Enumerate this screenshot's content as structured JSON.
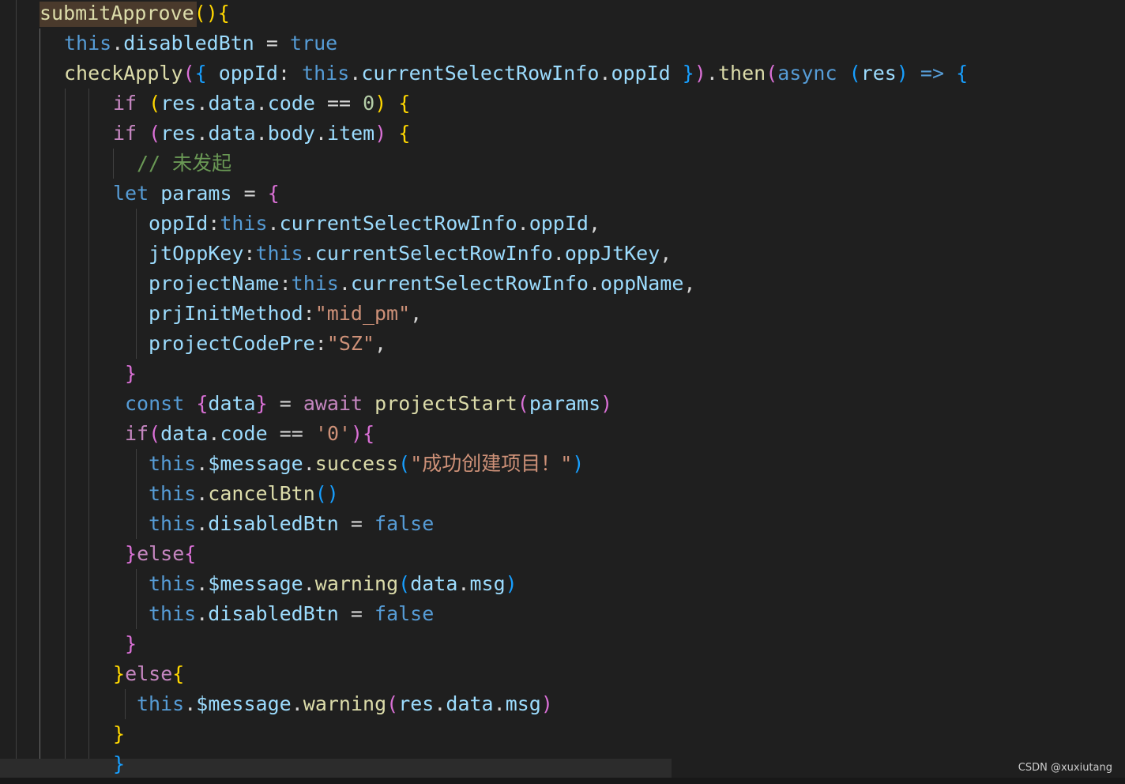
{
  "code": {
    "fn_name": "submitApprove",
    "kw_this": "this",
    "kw_true": "true",
    "kw_false": "false",
    "kw_if": "if",
    "kw_let": "let",
    "kw_const": "const",
    "kw_await": "await",
    "kw_async": "async",
    "kw_else": "else",
    "prop_disabledBtn": "disabledBtn",
    "fn_checkApply": "checkApply",
    "prop_oppId": "oppId",
    "prop_currentSelectRowInfo": "currentSelectRowInfo",
    "fn_then": "then",
    "var_res": "res",
    "prop_data": "data",
    "prop_code": "code",
    "num_zero": "0",
    "prop_body": "body",
    "prop_item": "item",
    "comment": "// 未发起",
    "var_params": "params",
    "prop_jtOppKey": "jtOppKey",
    "prop_oppJtKey": "oppJtKey",
    "prop_projectName": "projectName",
    "prop_oppName": "oppName",
    "prop_prjInitMethod": "prjInitMethod",
    "str_mid_pm": "\"mid_pm\"",
    "prop_projectCodePre": "projectCodePre",
    "str_SZ": "\"SZ\"",
    "var_data": "data",
    "fn_projectStart": "projectStart",
    "str_zero": "'0'",
    "prop_message": "$message",
    "fn_success": "success",
    "str_success_msg": "\"成功创建项目！\"",
    "fn_cancelBtn": "cancelBtn",
    "fn_warning": "warning",
    "prop_msg": "msg"
  },
  "watermark": "CSDN @xuxiutang"
}
